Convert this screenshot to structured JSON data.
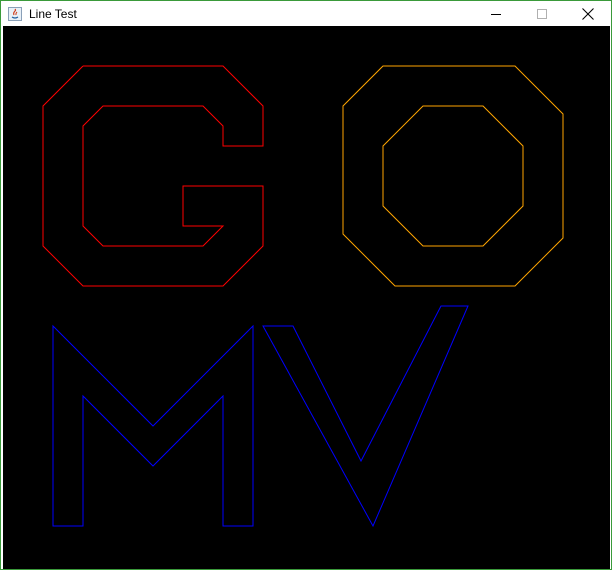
{
  "window": {
    "title": "Line Test",
    "title_icon": "java-icon",
    "controls": [
      "minimize-icon",
      "maximize-icon",
      "close-icon"
    ]
  },
  "canvas": {
    "background": "#000000",
    "shapes": [
      {
        "name": "letter-g",
        "letter": "G",
        "color": "#ff0000"
      },
      {
        "name": "letter-o",
        "letter": "O",
        "color": "#ffa500"
      },
      {
        "name": "letter-m",
        "letter": "M",
        "color": "#0000ff"
      },
      {
        "name": "letter-v",
        "letter": "V",
        "color": "#0000ff"
      }
    ]
  }
}
